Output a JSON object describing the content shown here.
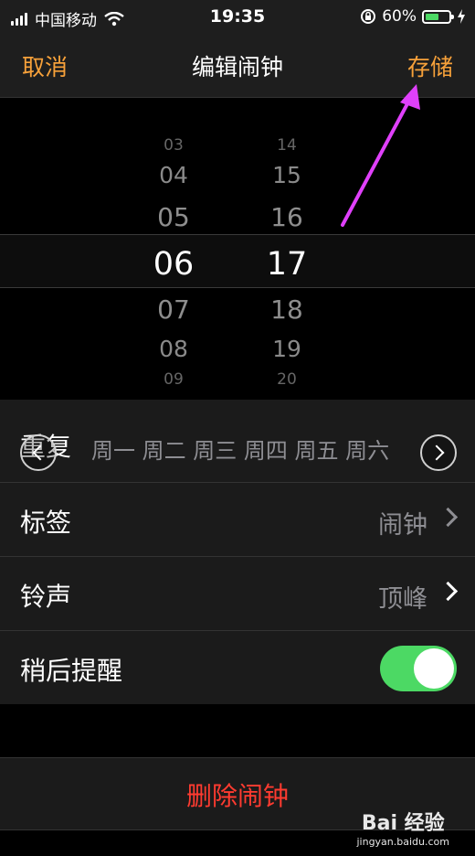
{
  "status_bar": {
    "carrier": "中国移动",
    "time": "19:35",
    "battery_percent": "60%",
    "battery_level": 0.6,
    "icons": [
      "signal-icon",
      "wifi-icon",
      "orientation-lock-icon",
      "battery-icon",
      "charging-icon"
    ]
  },
  "nav": {
    "cancel_label": "取消",
    "title": "编辑闹钟",
    "save_label": "存储"
  },
  "picker": {
    "hours": [
      "03",
      "04",
      "05",
      "06",
      "07",
      "08",
      "09"
    ],
    "minutes": [
      "14",
      "15",
      "16",
      "17",
      "18",
      "19",
      "20"
    ],
    "selected_hour": "06",
    "selected_minute": "17"
  },
  "settings": {
    "repeat_label": "重复",
    "repeat_value": "周一 周二 周三 周四 周五 周六",
    "label_label": "标签",
    "label_value": "闹钟",
    "sound_label": "铃声",
    "sound_value": "顶峰",
    "snooze_label": "稍后提醒",
    "snooze_on": true
  },
  "delete_label": "删除闹钟",
  "watermark": {
    "main": "Bai 经验",
    "url": "jingyan.baidu.com"
  },
  "colors": {
    "accent": "#f7a13a",
    "destructive": "#ff3b30",
    "toggle_on": "#4cd964",
    "annotation_arrow": "#e040fb"
  }
}
